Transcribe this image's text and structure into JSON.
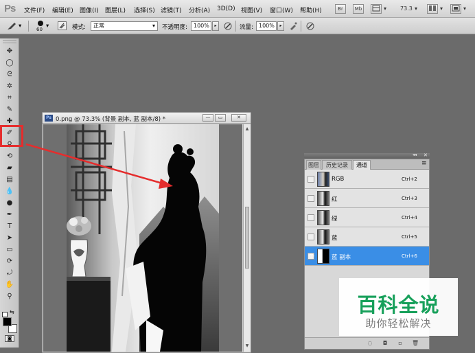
{
  "menubar": {
    "logo": "Ps",
    "items": [
      "文件(F)",
      "编辑(E)",
      "图像(I)",
      "图层(L)",
      "选择(S)",
      "滤镜(T)",
      "分析(A)",
      "3D(D)",
      "视图(V)",
      "窗口(W)",
      "帮助(H)"
    ],
    "bridge_label": "Br",
    "minibridge_label": "Mb",
    "zoom": "73.3",
    "dropdown_glyph": "▾",
    "window_controls": {
      "minimize": "—",
      "restore": "▭",
      "close": "✕"
    }
  },
  "options_bar": {
    "brush_size": "60",
    "mode_label": "模式:",
    "mode_value": "正常",
    "opacity_label": "不透明度:",
    "opacity_value": "100%",
    "flow_label": "流量:",
    "flow_value": "100%",
    "arrow_glyph": "▸",
    "caret_glyph": "▾"
  },
  "toolbox": {
    "tools": [
      {
        "name": "move-tool-icon",
        "glyph": "✥"
      },
      {
        "name": "marquee-tool-icon",
        "glyph": "◯"
      },
      {
        "name": "lasso-tool-icon",
        "glyph": "ᘓ"
      },
      {
        "name": "quick-select-tool-icon",
        "glyph": "✲"
      },
      {
        "name": "crop-tool-icon",
        "glyph": "⌗"
      },
      {
        "name": "eyedropper-tool-icon",
        "glyph": "✎"
      },
      {
        "name": "healing-brush-tool-icon",
        "glyph": "✚"
      },
      {
        "name": "brush-tool-icon",
        "glyph": "✐"
      },
      {
        "name": "clone-stamp-tool-icon",
        "glyph": "⚲"
      },
      {
        "name": "history-brush-tool-icon",
        "glyph": "⟲"
      },
      {
        "name": "eraser-tool-icon",
        "glyph": "▰"
      },
      {
        "name": "gradient-tool-icon",
        "glyph": "▤"
      },
      {
        "name": "blur-tool-icon",
        "glyph": "💧"
      },
      {
        "name": "dodge-tool-icon",
        "glyph": "●"
      },
      {
        "name": "pen-tool-icon",
        "glyph": "✒"
      },
      {
        "name": "type-tool-icon",
        "glyph": "T"
      },
      {
        "name": "path-select-tool-icon",
        "glyph": "➤"
      },
      {
        "name": "shape-tool-icon",
        "glyph": "▭"
      },
      {
        "name": "3d-rotate-tool-icon",
        "glyph": "⟳"
      },
      {
        "name": "3d-orbit-tool-icon",
        "glyph": "⤾"
      },
      {
        "name": "hand-tool-icon",
        "glyph": "✋"
      },
      {
        "name": "zoom-tool-icon",
        "glyph": "⚲"
      }
    ],
    "quick_mask_glyph": "◙"
  },
  "document": {
    "title": "0.png @ 73.3% (背景 副本, 蓝 副本/8) *",
    "badge": "Ps",
    "controls": {
      "minimize": "—",
      "restore": "▭",
      "close": "✕"
    },
    "scroll_up": "▲",
    "scroll_down": "▼"
  },
  "channels_panel": {
    "collapse_glyph": "◂◂",
    "close_glyph": "✕",
    "menu_glyph": "≡",
    "tabs": [
      {
        "label": "图层",
        "active": false
      },
      {
        "label": "历史记录",
        "active": false
      },
      {
        "label": "通道",
        "active": true
      }
    ],
    "channels": [
      {
        "name": "RGB",
        "shortcut": "Ctrl+2",
        "visible": false,
        "selected": false,
        "thumb": "color"
      },
      {
        "name": "红",
        "shortcut": "Ctrl+3",
        "visible": false,
        "selected": false,
        "thumb": "gray"
      },
      {
        "name": "绿",
        "shortcut": "Ctrl+4",
        "visible": false,
        "selected": false,
        "thumb": "gray"
      },
      {
        "name": "蓝",
        "shortcut": "Ctrl+5",
        "visible": false,
        "selected": false,
        "thumb": "gray"
      },
      {
        "name": "蓝 副本",
        "shortcut": "Ctrl+6",
        "visible": true,
        "selected": true,
        "thumb": "mask"
      }
    ],
    "eye_glyph": "👁",
    "bottom_icons": [
      {
        "name": "load-selection-icon",
        "glyph": "◌"
      },
      {
        "name": "save-selection-icon",
        "glyph": "◘"
      },
      {
        "name": "new-channel-icon",
        "glyph": "▫"
      },
      {
        "name": "delete-channel-icon",
        "glyph": "🗑"
      }
    ]
  },
  "watermark": {
    "title": "百科全说",
    "subtitle": "助你轻松解决"
  },
  "colors": {
    "selection_blue": "#3a8ee6",
    "annotation_red": "#e52d2d",
    "watermark_green": "#17a05a"
  }
}
